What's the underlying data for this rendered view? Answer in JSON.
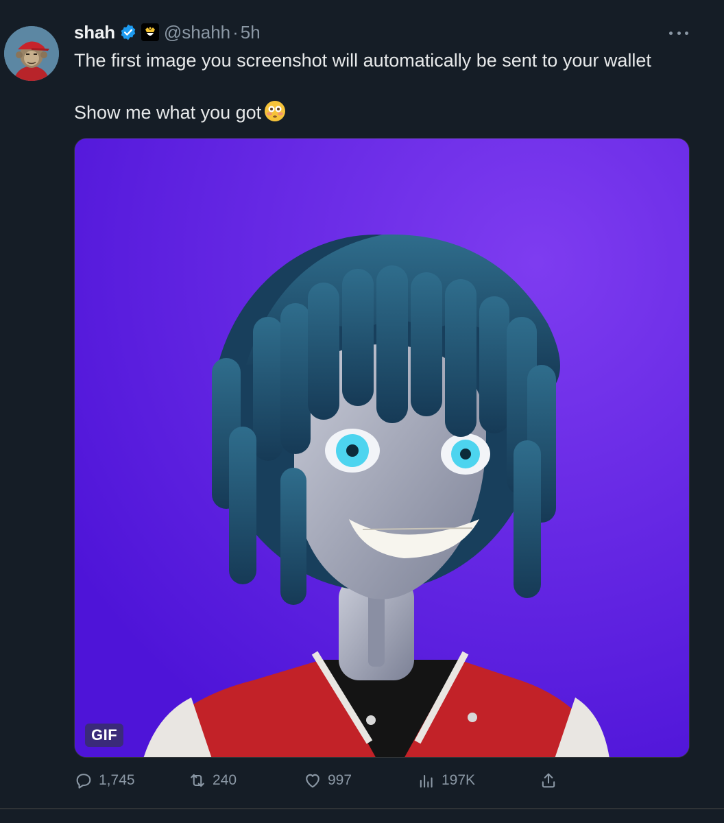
{
  "author": {
    "display_name": "shah",
    "handle": "@shahh",
    "separator": "·",
    "time": "5h"
  },
  "tweet": {
    "line1": "The first image you screenshot will automatically be sent to your wallet",
    "line2": "Show me what you got",
    "emoji": "flushed-face-emoji"
  },
  "media": {
    "badge": "GIF",
    "background_color": "#5a18e0"
  },
  "actions": {
    "replies": "1,745",
    "reposts": "240",
    "likes": "997",
    "views": "197K"
  },
  "colors": {
    "background": "#151d26",
    "secondary_text": "#8b98a5",
    "verified": "#1d9bf0"
  }
}
